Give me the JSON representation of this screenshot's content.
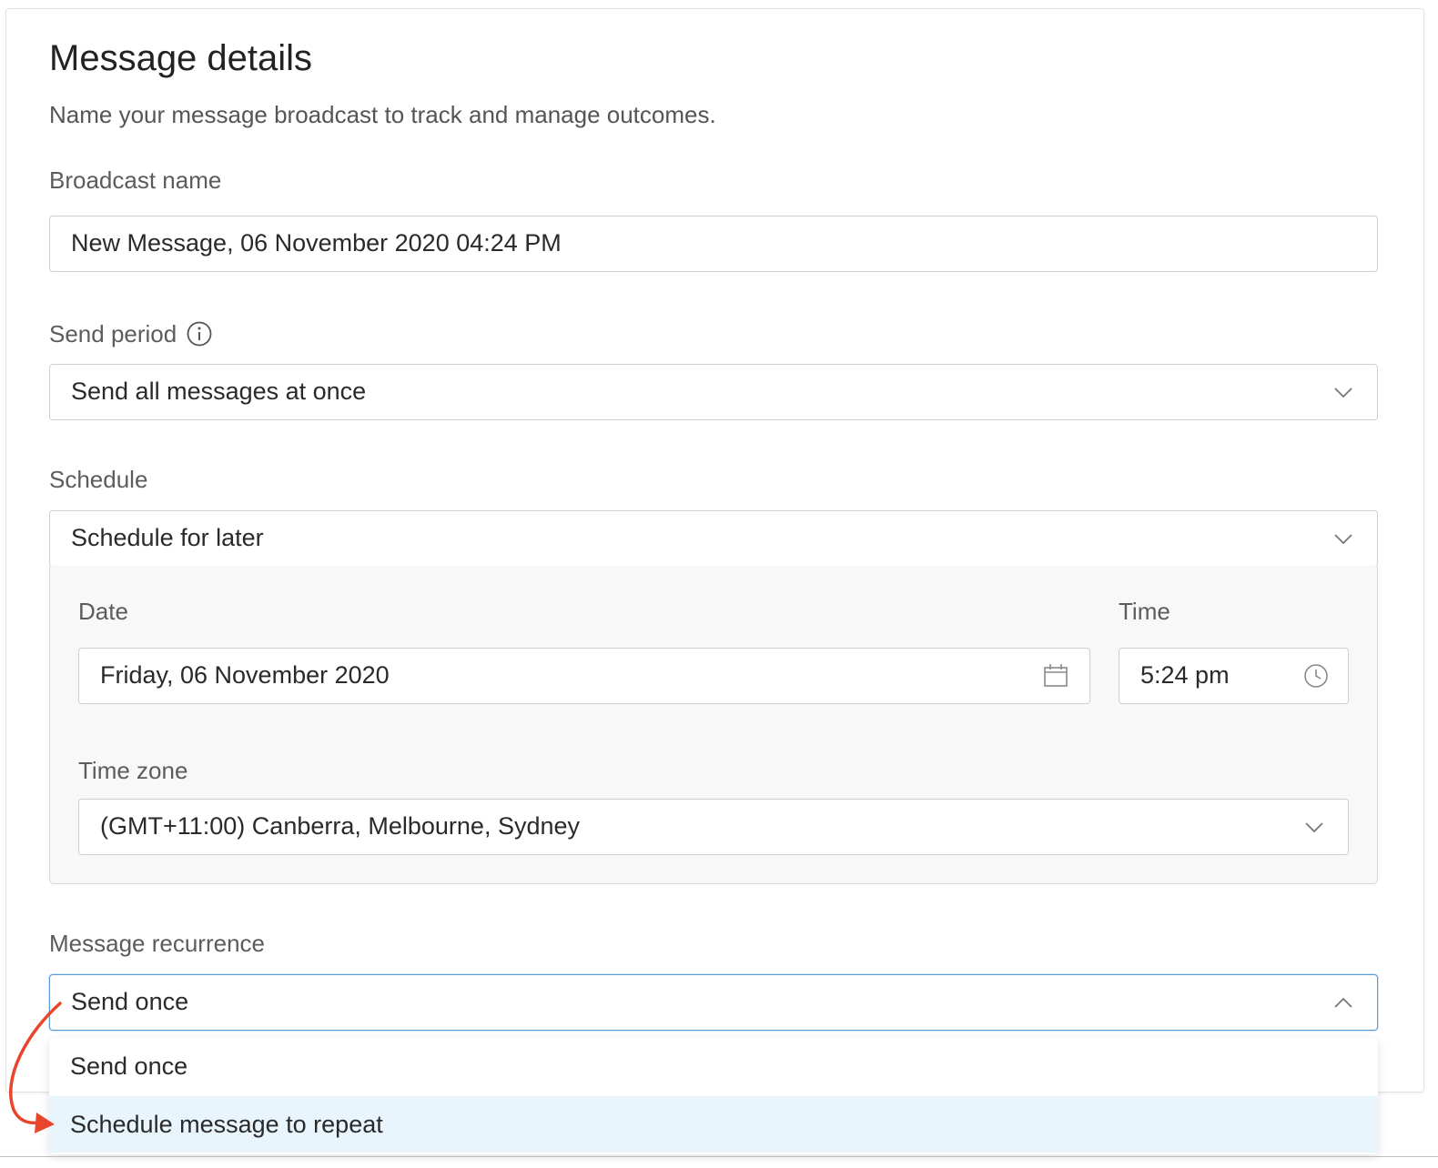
{
  "header": {
    "title": "Message details",
    "subtitle": "Name your message broadcast to track and manage outcomes."
  },
  "broadcast_name": {
    "label": "Broadcast name",
    "value": "New Message, 06 November 2020 04:24 PM"
  },
  "send_period": {
    "label": "Send period",
    "info_icon": "info-icon",
    "value": "Send all messages at once"
  },
  "schedule": {
    "label": "Schedule",
    "value": "Schedule for later",
    "date": {
      "label": "Date",
      "value": "Friday, 06 November 2020",
      "icon": "calendar-icon"
    },
    "time": {
      "label": "Time",
      "value": "5:24 pm",
      "icon": "clock-icon"
    },
    "timezone": {
      "label": "Time zone",
      "value": "(GMT+11:00) Canberra, Melbourne, Sydney"
    }
  },
  "recurrence": {
    "label": "Message recurrence",
    "value": "Send once",
    "options": [
      "Send once",
      "Schedule message to repeat"
    ],
    "highlighted_option": "Schedule message to repeat"
  },
  "colors": {
    "focus_border": "#5b9bd5",
    "highlight_bg": "#e9f5fc",
    "annotation_arrow": "#e8452c"
  }
}
